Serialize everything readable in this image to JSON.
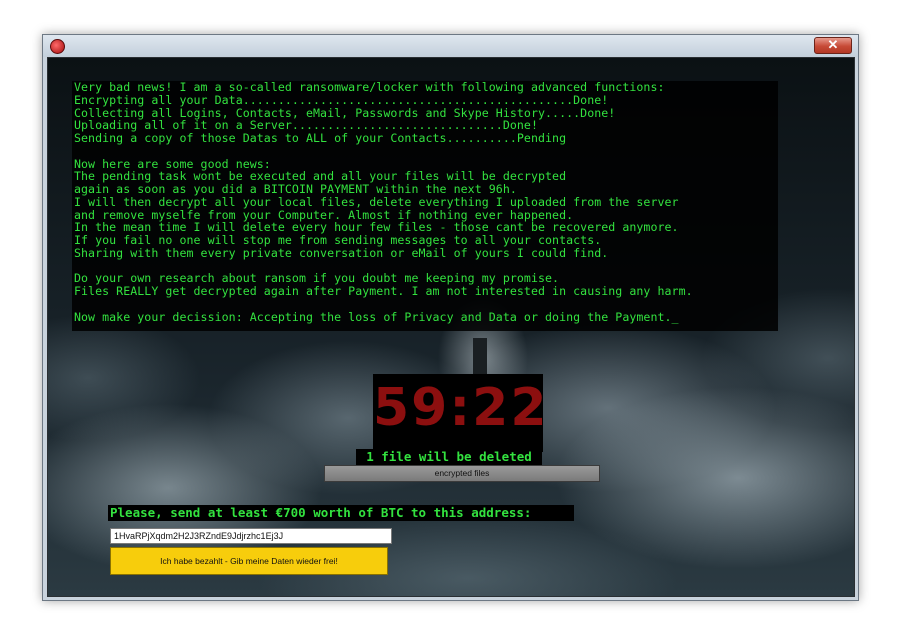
{
  "window": {
    "close_label": "✕",
    "app_icon": "ransomware-app-icon"
  },
  "terminal": {
    "lines": [
      "Very bad news! I am a so-called ransomware/locker with following advanced functions:",
      "Encrypting all your Data...............................................Done!",
      "Collecting all Logins, Contacts, eMail, Passwords and Skype History.....Done!",
      "Uploading all of it on a Server..............................Done!",
      "Sending a copy of those Datas to ALL of your Contacts..........Pending",
      "",
      "Now here are some good news:",
      "The pending task wont be executed and all your files will be decrypted",
      "again as soon as you did a BITCOIN PAYMENT within the next 96h.",
      "I will then decrypt all your local files, delete everything I uploaded from the server",
      "and remove myselfe from your Computer. Almost if nothing ever happened.",
      "In the mean time I will delete every hour few files - those cant be recovered anymore.",
      "If you fail no one will stop me from sending messages to all your contacts.",
      "Sharing with them every private conversation or eMail of yours I could find.",
      "",
      "Do your own research about ransom if you doubt me keeping my promise.",
      "Files REALLY get decrypted again after Payment. I am not interested in causing any harm.",
      "",
      "Now make your decission: Accepting the loss of Privacy and Data or doing the Payment._"
    ]
  },
  "timer": {
    "value": "59:22",
    "color": "#8c0f0f"
  },
  "status": {
    "deleted_label": "1 file will be deleted",
    "encrypted_files_button": "encrypted files"
  },
  "payment": {
    "prompt": "Please, send at least €700 worth of BTC to this address:",
    "address": "1HvaRPjXqdm2H2J3RZndE9Jdjrzhc1Ej3J",
    "paid_button": "Ich habe bezahlt - Gib meine Daten wieder frei!"
  },
  "colors": {
    "terminal_text": "#33e23f",
    "paid_button": "#f7cd0c"
  }
}
